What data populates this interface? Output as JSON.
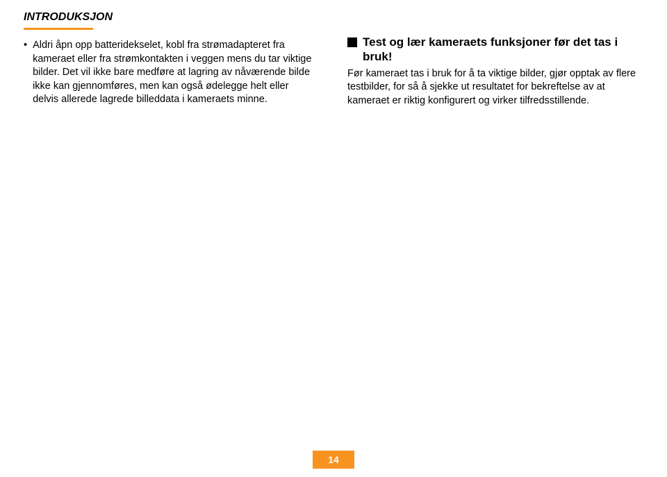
{
  "page_title": "INTRODUKSJON",
  "left": {
    "bullet": "•",
    "text": "Aldri åpn opp batteridekselet, kobl fra strømadapteret fra kameraet eller fra strømkontakten i veggen mens du tar viktige bilder. Det vil ikke bare medføre at lagring av nåværende bilde ikke kan gjennomføres, men kan også ødelegge helt eller delvis allerede lagrede billeddata i kameraets minne."
  },
  "right": {
    "heading": "Test og lær kameraets funksjoner før det tas i bruk!",
    "body": "Før kameraet tas i bruk for å ta viktige bilder, gjør opptak av flere testbilder, for så å sjekke ut resultatet for bekreftelse av at kameraet er riktig konfigurert og virker tilfredsstillende."
  },
  "page_number": "14"
}
